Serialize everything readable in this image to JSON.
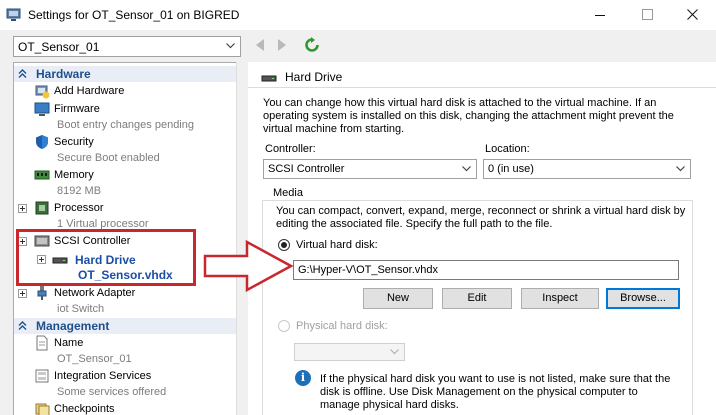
{
  "window": {
    "title": "Settings for OT_Sensor_01 on BIGRED"
  },
  "vm_select": {
    "value": "OT_Sensor_01"
  },
  "tree": {
    "hardware_section": "Hardware",
    "management_section": "Management",
    "items": [
      {
        "label": "Add Hardware",
        "sub": ""
      },
      {
        "label": "Firmware",
        "sub": "Boot entry changes pending"
      },
      {
        "label": "Security",
        "sub": "Secure Boot enabled"
      },
      {
        "label": "Memory",
        "sub": "8192 MB"
      },
      {
        "label": "Processor",
        "sub": "1 Virtual processor"
      },
      {
        "label": "SCSI Controller",
        "sub": ""
      },
      {
        "label": "Hard Drive",
        "sub": "OT_Sensor.vhdx"
      },
      {
        "label": "Network Adapter",
        "sub": "iot Switch"
      },
      {
        "label": "Name",
        "sub": "OT_Sensor_01"
      },
      {
        "label": "Integration Services",
        "sub": "Some services offered"
      },
      {
        "label": "Checkpoints",
        "sub": ""
      }
    ]
  },
  "panel": {
    "title": "Hard Drive",
    "description": "You can change how this virtual hard disk is attached to the virtual machine. If an operating system is installed on this disk, changing the attachment might prevent the virtual machine from starting.",
    "controller_label": "Controller:",
    "controller_value": "SCSI Controller",
    "location_label": "Location:",
    "location_value": "0 (in use)",
    "media_label": "Media",
    "media_desc": "You can compact, convert, expand, merge, reconnect or shrink a virtual hard disk by editing the associated file. Specify the full path to the file.",
    "vhd_radio_label": "Virtual hard disk:",
    "vhd_path": "G:\\Hyper-V\\OT_Sensor.vhdx",
    "buttons": {
      "new": "New",
      "edit": "Edit",
      "inspect": "Inspect",
      "browse": "Browse..."
    },
    "phys_radio_label": "Physical hard disk:",
    "phys_info": "If the physical hard disk you want to use is not listed, make sure that the disk is offline. Use Disk Management on the physical computer to manage physical hard disks."
  },
  "colors": {
    "annotation": "#c8282d",
    "section_text": "#1e4f8c",
    "selected_text": "#1a4fa3"
  }
}
